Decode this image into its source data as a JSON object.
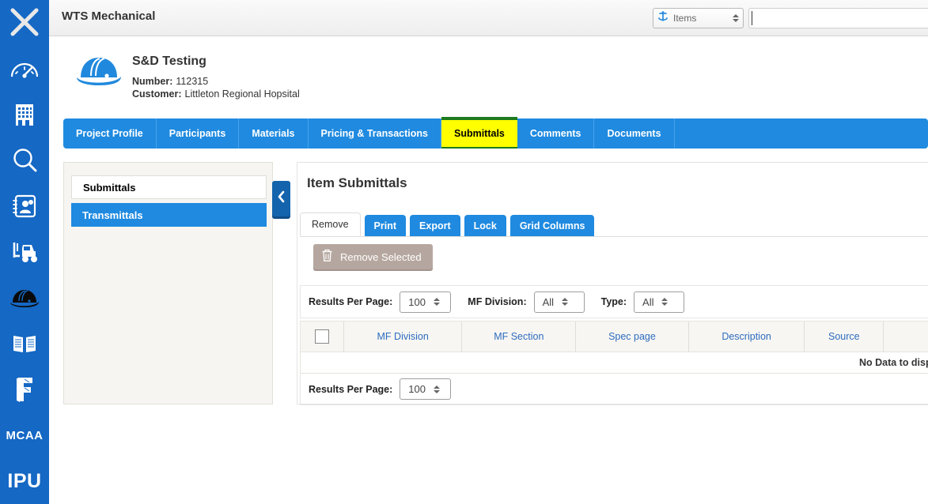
{
  "rail": {
    "items": [
      {
        "name": "close-icon",
        "label": "X"
      },
      {
        "name": "dashboard-gauge-icon",
        "label": "Dashboard"
      },
      {
        "name": "building-icon",
        "label": "Company"
      },
      {
        "name": "search-icon",
        "label": "Search"
      },
      {
        "name": "contacts-icon",
        "label": "Contacts"
      },
      {
        "name": "forklift-icon",
        "label": "Warehouse"
      },
      {
        "name": "hardhat-icon",
        "label": "Projects"
      },
      {
        "name": "book-icon",
        "label": "Library"
      },
      {
        "name": "f-logo-icon",
        "label": "F"
      },
      {
        "name": "mcaa-logo",
        "label": "MCAA"
      },
      {
        "name": "ipu-logo",
        "label": "IPU"
      }
    ],
    "mcaa_text": "MCAA",
    "ipu_text": "IPU"
  },
  "topbar": {
    "app_title": "WTS Mechanical",
    "items_select_label": "Items",
    "items_select_icon": "anchor-icon",
    "search_value": ""
  },
  "project": {
    "logo_icon": "hardhat-icon",
    "name": "S&D Testing",
    "number_label": "Number:",
    "number_value": "112315",
    "customer_label": "Customer:",
    "customer_value": "Littleton Regional Hopsital"
  },
  "nav": {
    "tabs": [
      {
        "label": "Project Profile",
        "active": false
      },
      {
        "label": "Participants",
        "active": false
      },
      {
        "label": "Materials",
        "active": false
      },
      {
        "label": "Pricing & Transactions",
        "active": false
      },
      {
        "label": "Submittals",
        "active": true
      },
      {
        "label": "Comments",
        "active": false
      },
      {
        "label": "Documents",
        "active": false
      }
    ],
    "highlight_color": "#ffff00"
  },
  "subpanel": {
    "header": "Submittals",
    "selected_item": "Transmittals",
    "collapse_icon": "chevron-left-icon"
  },
  "main": {
    "title": "Item Submittals",
    "toolbar": {
      "active_tab": "Remove",
      "buttons": [
        {
          "label": "Print"
        },
        {
          "label": "Export"
        },
        {
          "label": "Lock"
        },
        {
          "label": "Grid Columns"
        }
      ],
      "remove_selected": {
        "label": "Remove Selected",
        "icon": "trash-icon",
        "disabled_color": "#b5a79f"
      }
    },
    "filters": {
      "results_per_page_label": "Results Per Page:",
      "results_per_page_value": "100",
      "mf_division_label": "MF Division:",
      "mf_division_value": "All",
      "type_label": "Type:",
      "type_value": "All"
    },
    "grid": {
      "select_all_checkbox": false,
      "columns": [
        "MF Division",
        "MF Section",
        "Spec page",
        "Description",
        "Source",
        ""
      ],
      "rows": [],
      "empty_message": "No Data to display"
    },
    "footer": {
      "results_per_page_label": "Results Per Page:",
      "results_per_page_value": "100"
    }
  }
}
